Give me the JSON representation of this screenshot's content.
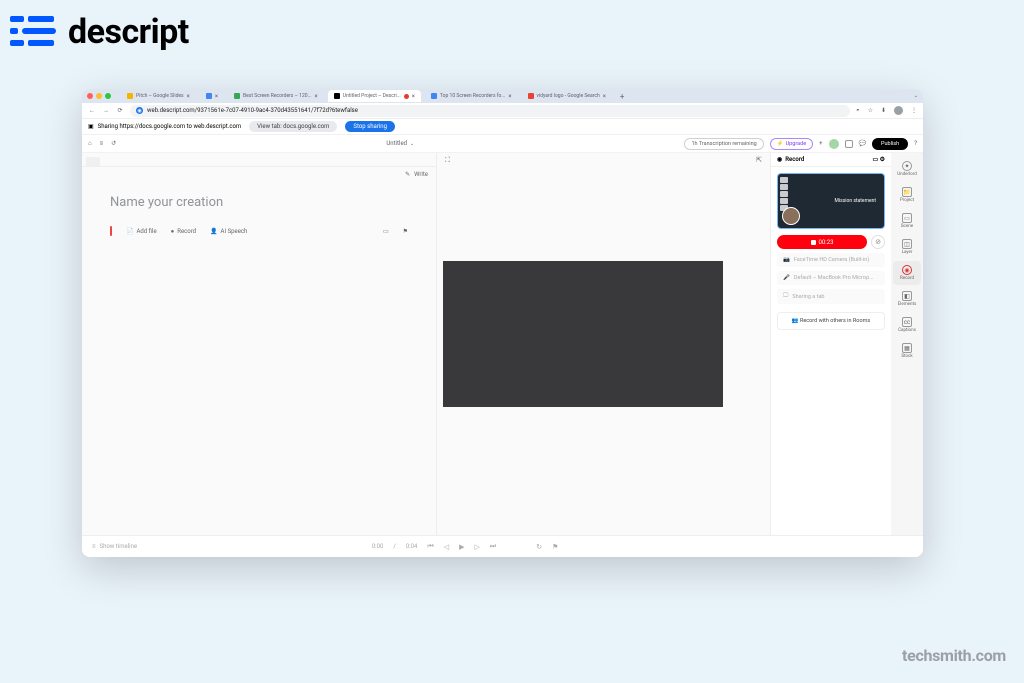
{
  "brand": {
    "name": "descript"
  },
  "watermark": "techsmith.com",
  "browser": {
    "url": "web.descript.com/9371561e-7c07-4910-9ac4-370d43551641/7f72d?6tewfalse",
    "tabs": [
      {
        "title": "Pitch – Google Slides",
        "active": false
      },
      {
        "title": "",
        "active": false
      },
      {
        "title": "Best Screen Recorders – 120...",
        "active": false
      },
      {
        "title": "Untitled Project – Descri...",
        "active": true
      },
      {
        "title": "Top 10 Screen Recorders fo...",
        "active": false
      },
      {
        "title": "vidyard logo - Google Search",
        "active": false
      }
    ],
    "share_text": "Sharing https://docs.google.com to web.descript.com",
    "view_tab": "View tab: docs.google.com",
    "stop_sharing": "Stop sharing"
  },
  "app": {
    "project_name": "Untitled",
    "transcribe": "1h Transcription remaining",
    "upgrade": "Upgrade",
    "publish": "Publish"
  },
  "editor": {
    "write_label": "Write",
    "title_placeholder": "Name your creation",
    "addfile": "Add file",
    "record": "Record",
    "aispeech": "AI Speech"
  },
  "record_panel": {
    "title": "Record",
    "mission": "Mission statement",
    "timer": "00:23",
    "camera": "FaceTime HD Camera (Built-in)",
    "mic": "Default – MacBook Pro Microp...",
    "screen": "Sharing a tab",
    "rooms": "Record with others in Rooms"
  },
  "rail": {
    "underlord": "Underlord",
    "project": "Project",
    "scene": "Scene",
    "layer": "Layer",
    "record": "Record",
    "elements": "Elements",
    "captions": "Captions",
    "stock": "Stock"
  },
  "bottom": {
    "show_timeline": "Show timeline",
    "time": "0:00",
    "duration": "0:04"
  }
}
